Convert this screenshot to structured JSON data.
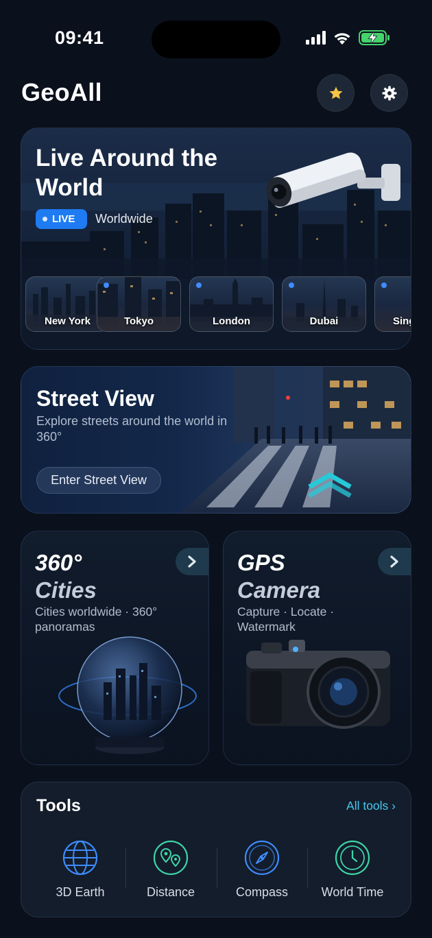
{
  "status": {
    "time": "09:41"
  },
  "header": {
    "title": "GeoAll",
    "favorites_icon": "star-icon",
    "settings_icon": "gear-icon"
  },
  "live_card": {
    "title": "Live Around the World",
    "badge": "LIVE",
    "subtitle": "Worldwide",
    "cities": [
      {
        "name": "New York"
      },
      {
        "name": "Tokyo"
      },
      {
        "name": "London"
      },
      {
        "name": "Dubai"
      },
      {
        "name": "Sing"
      }
    ]
  },
  "street_view": {
    "title": "Street View",
    "subtitle": "Explore streets around the world in 360°",
    "button": "Enter Street View"
  },
  "features": [
    {
      "title_line1": "360°",
      "title_line2": "Cities",
      "subtitle": "Cities worldwide · 360° panoramas"
    },
    {
      "title_line1": "GPS",
      "title_line2": "Camera",
      "subtitle": "Capture · Locate · Watermark"
    }
  ],
  "tools": {
    "title": "Tools",
    "all_link": "All tools  ›",
    "items": [
      {
        "label": "3D Earth",
        "icon": "globe-icon",
        "color": "#3f8cff"
      },
      {
        "label": "Distance",
        "icon": "map-pin-icon",
        "color": "#3fd6a8"
      },
      {
        "label": "Compass",
        "icon": "compass-icon",
        "color": "#3f8cff"
      },
      {
        "label": "World Time",
        "icon": "clock-icon",
        "color": "#3fd6a8"
      }
    ]
  },
  "colors": {
    "accent_blue": "#1e7bf2",
    "accent_cyan": "#48c7ee",
    "background": "#0a111c"
  }
}
